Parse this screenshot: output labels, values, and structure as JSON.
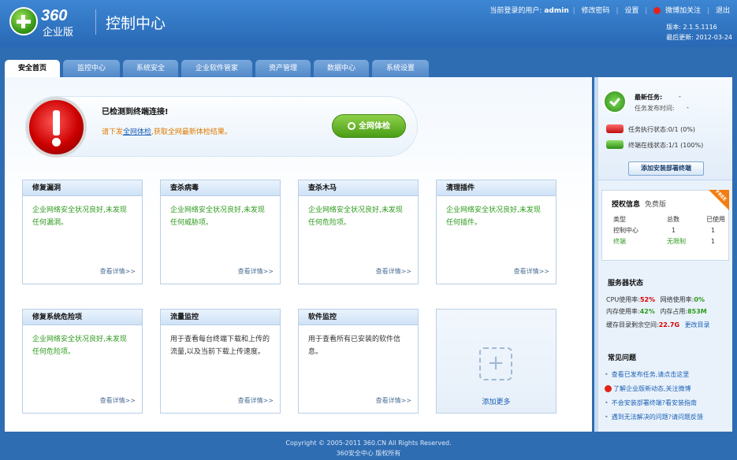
{
  "header": {
    "logo_text": "360",
    "logo_sub": "企业版",
    "title": "控制中心",
    "user_label": "当前登录的用户:",
    "user_name": "admin",
    "change_password": "修改密码",
    "settings": "设置",
    "weibo": "微博加关注",
    "logout": "退出",
    "version": "版本: 2.1.5.1116",
    "last_update": "最后更新: 2012-03-24"
  },
  "tabs": [
    "安全首页",
    "监控中心",
    "系统安全",
    "企业软件管家",
    "资产管理",
    "数据中心",
    "系统设置"
  ],
  "alert": {
    "title": "已检测到终端连接!",
    "desc_prefix": "请下发",
    "desc_link": "全网体检",
    "desc_suffix": ",获取全网最新体检结果。",
    "scan_button": "全网体检"
  },
  "cards": [
    {
      "title": "修复漏洞",
      "body": "企业网络安全状况良好,未发现任何漏洞。",
      "link": "查看详情>>"
    },
    {
      "title": "查杀病毒",
      "body": "企业网络安全状况良好,未发现任何威胁项。",
      "link": "查看详情>>"
    },
    {
      "title": "查杀木马",
      "body": "企业网络安全状况良好,未发现任何危险项。",
      "link": "查看详情>>"
    },
    {
      "title": "清理插件",
      "body": "企业网络安全状况良好,未发现任何插件。",
      "link": "查看详情>>"
    },
    {
      "title": "修复系统危险项",
      "body": "企业网络安全状况良好,未发现任何危险项。",
      "link": "查看详情>>"
    },
    {
      "title": "流量监控",
      "body": "用于查看每台终端下载和上传的流量,以及当前下载上传速度。",
      "link": "查看详情>>"
    },
    {
      "title": "软件监控",
      "body": "用于查看所有已安装的软件信息。",
      "link": "查看详情>>"
    }
  ],
  "add_more": "添加更多",
  "sidebar": {
    "latest_task_label": "最新任务:",
    "latest_task_value": "-",
    "task_time_label": "任务发布时间:",
    "task_time_value": "-",
    "task_status": "任务执行状态:0/1 (0%)",
    "online_status": "终端在线状态:1/1 (100%)",
    "deploy_button": "添加安装部署终端",
    "license_title": "授权信息",
    "license_edition": "免费版",
    "license_headers": [
      "类型",
      "总数",
      "已使用"
    ],
    "license_rows": [
      [
        "控制中心",
        "1",
        "1"
      ],
      [
        "终端",
        "无限制",
        "1"
      ]
    ],
    "ribbon": "FREE",
    "server_title": "服务器状态",
    "cpu_label": "CPU使用率:",
    "cpu_value": "52%",
    "net_label": "网络使用率:",
    "net_value": "0%",
    "mem_label": "内存使用率:",
    "mem_value": "42%",
    "mem_use_label": "内存占用:",
    "mem_use_value": "853M",
    "disk_label": "缓存目录剩余空间:",
    "disk_value": "22.7G",
    "change_dir": "更改目录",
    "faq_title": "常见问题",
    "faq": [
      "查看已发布任务,请点击这里",
      "了解企业版新动态,关注微博",
      "不会安装部署终端?看安装指南",
      "遇到无法解决的问题?请问题反馈"
    ]
  },
  "footer": {
    "copyright": "Copyright © 2005-2011 360.CN All Rights Reserved.",
    "owner": "360安全中心 版权所有"
  }
}
